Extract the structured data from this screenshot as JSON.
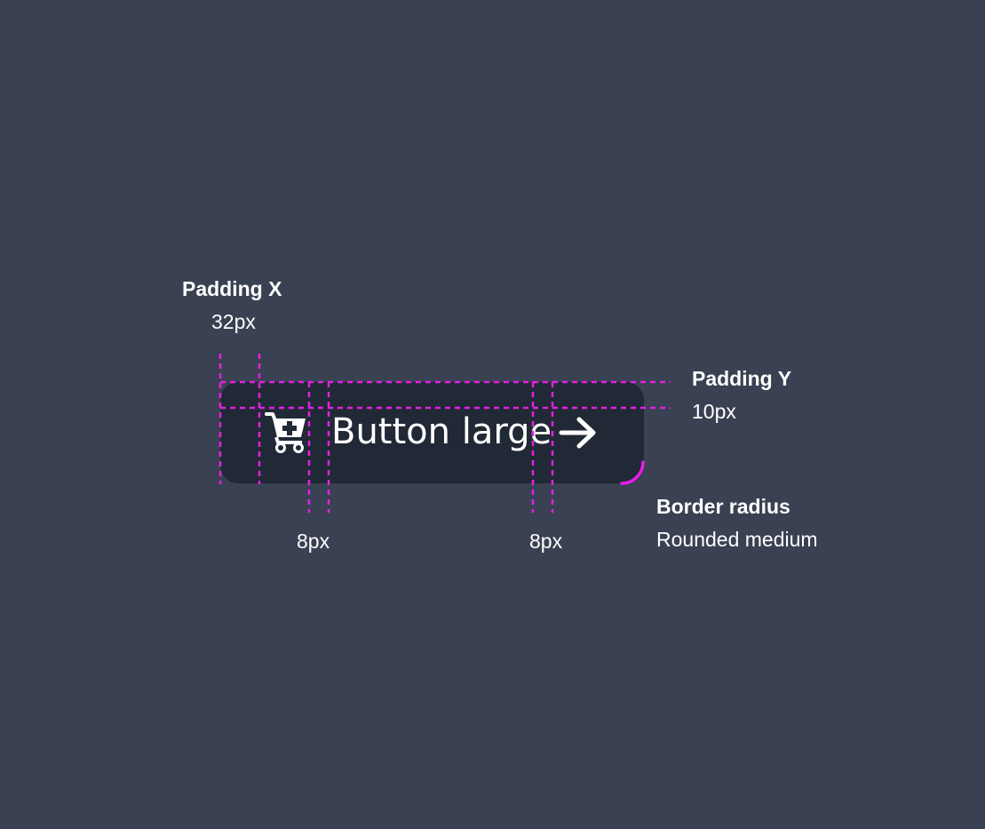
{
  "annotations": {
    "padding_x": {
      "title": "Padding X",
      "value": "32px"
    },
    "padding_y": {
      "title": "Padding Y",
      "value": "10px"
    },
    "gap_left": {
      "value": "8px"
    },
    "gap_right": {
      "value": "8px"
    },
    "border_radius": {
      "title": "Border radius",
      "value": "Rounded medium"
    }
  },
  "button": {
    "label": "Button large",
    "leading_icon": "cart-plus-icon",
    "trailing_icon": "arrow-right-icon"
  },
  "colors": {
    "background": "#394152",
    "button_bg": "#212936",
    "guide": "#e81ee6",
    "text": "#ffffff"
  }
}
